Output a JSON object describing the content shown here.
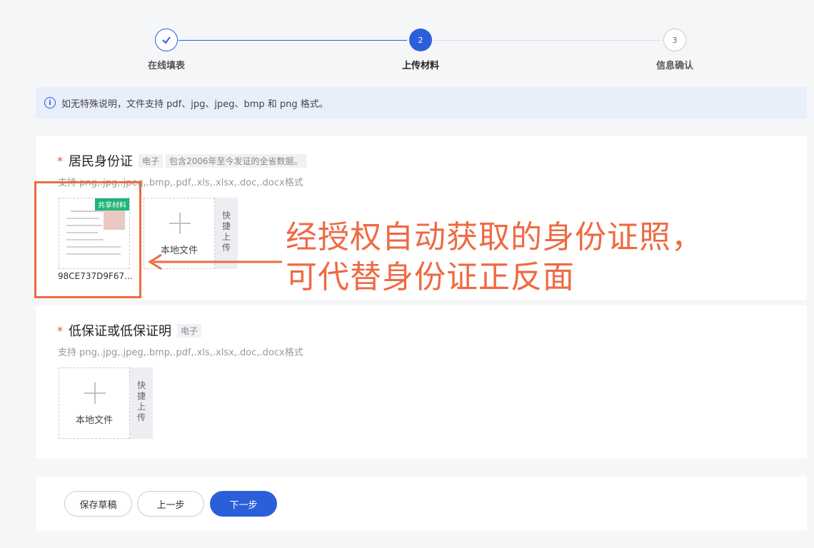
{
  "stepper": {
    "steps": [
      {
        "label": "在线填表",
        "state": "done"
      },
      {
        "label": "上传材料",
        "state": "active",
        "number": "2"
      },
      {
        "label": "信息确认",
        "state": "todo",
        "number": "3"
      }
    ]
  },
  "notice": {
    "text": "如无特殊说明，文件支持 pdf、jpg、jpeg、bmp 和 png 格式。"
  },
  "sections": [
    {
      "required_mark": "*",
      "title": "居民身份证",
      "tag": "电子",
      "tag_note": "包含2006年至今发证的全省数据。",
      "hint": "支持 png,.jpg,.jpeg,.bmp,.pdf,.xls,.xlsx,.doc,.docx格式",
      "uploaded_file": {
        "badge": "共享材料",
        "name": "98CE737D9F67..."
      },
      "local_upload_label": "本地文件",
      "quick_upload_label": [
        "快",
        "捷",
        "上",
        "传"
      ]
    },
    {
      "required_mark": "*",
      "title": "低保证或低保证明",
      "tag": "电子",
      "hint": "支持 png,.jpg,.jpeg,.bmp,.pdf,.xls,.xlsx,.doc,.docx格式",
      "local_upload_label": "本地文件",
      "quick_upload_label": [
        "快",
        "捷",
        "上",
        "传"
      ]
    }
  ],
  "annotation": {
    "lines": [
      "经授权自动获取的身份证照，",
      "可代替身份证正反面"
    ],
    "color": "#ee6a43"
  },
  "footer": {
    "save_draft": "保存草稿",
    "prev": "上一步",
    "next": "下一步"
  },
  "colors": {
    "primary": "#2b5fd9",
    "shared_badge": "#1fb47a",
    "required": "#e8543a"
  }
}
